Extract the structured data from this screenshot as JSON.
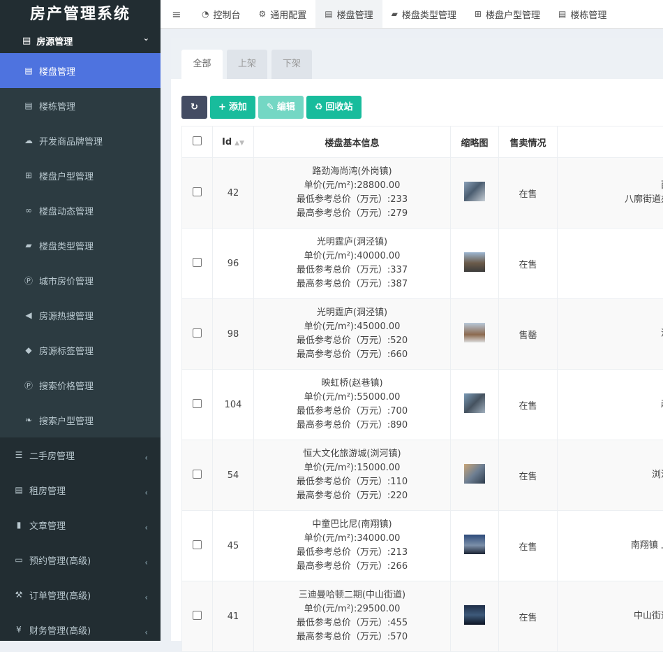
{
  "app_title": "房产管理系统",
  "sidebar": {
    "group": {
      "label": "房源管理"
    },
    "items": [
      {
        "label": "楼盘管理",
        "icon": "building-icon"
      },
      {
        "label": "楼栋管理",
        "icon": "building-icon"
      },
      {
        "label": "开发商品牌管理",
        "icon": "cloud-icon"
      },
      {
        "label": "楼盘户型管理",
        "icon": "sitemap-icon"
      },
      {
        "label": "楼盘动态管理",
        "icon": "tripadvisor-icon"
      },
      {
        "label": "楼盘类型管理",
        "icon": "book-icon"
      },
      {
        "label": "城市房价管理",
        "icon": "parking-icon"
      },
      {
        "label": "房源热搜管理",
        "icon": "bullhorn-icon"
      },
      {
        "label": "房源标签管理",
        "icon": "tags-icon"
      },
      {
        "label": "搜索价格管理",
        "icon": "parking-icon"
      },
      {
        "label": "搜索户型管理",
        "icon": "leaf-icon"
      }
    ],
    "top_items": [
      {
        "label": "二手房管理",
        "icon": "list-icon"
      },
      {
        "label": "租房管理",
        "icon": "building-icon"
      },
      {
        "label": "文章管理",
        "icon": "file-icon"
      },
      {
        "label": "预约管理(高级)",
        "icon": "laptop-icon"
      },
      {
        "label": "订单管理(高级)",
        "icon": "gavel-icon"
      },
      {
        "label": "财务管理(高级)",
        "icon": "yen-icon"
      }
    ]
  },
  "topbar": {
    "tabs": [
      {
        "label": "控制台",
        "icon": "dashboard-icon"
      },
      {
        "label": "通用配置",
        "icon": "cog-icon"
      },
      {
        "label": "楼盘管理",
        "icon": "building-icon"
      },
      {
        "label": "楼盘类型管理",
        "icon": "book-icon"
      },
      {
        "label": "楼盘户型管理",
        "icon": "sitemap-icon"
      },
      {
        "label": "楼栋管理",
        "icon": "building-icon"
      }
    ]
  },
  "status_tabs": [
    "全部",
    "上架",
    "下架"
  ],
  "toolbar": {
    "add_label": "添加",
    "edit_label": "编辑",
    "recycle_label": "回收站"
  },
  "table": {
    "headers": {
      "id": "Id",
      "info": "楼盘基本信息",
      "thumb": "缩略图",
      "sale": "售卖情况"
    },
    "rows": [
      {
        "id": "42",
        "name": "路劲海尚湾(外岗镇)",
        "price": "单价(元/m²):28800.00",
        "min": "最低参考总价（万元）:233",
        "max": "最高参考总价（万元）:279",
        "sale": "在售",
        "addr1": "西",
        "addr2": "八廓街道办"
      },
      {
        "id": "96",
        "name": "光明霆庐(洞泾镇)",
        "price": "单价(元/m²):40000.00",
        "min": "最低参考总价（万元）:337",
        "max": "最高参考总价（万元）:387",
        "sale": "在售",
        "addr1": "",
        "addr2": ""
      },
      {
        "id": "98",
        "name": "光明霆庐(洞泾镇)",
        "price": "单价(元/m²):45000.00",
        "min": "最低参考总价（万元）:520",
        "max": "最高参考总价（万元）:660",
        "sale": "售罄",
        "addr1": "",
        "addr2": "洞"
      },
      {
        "id": "104",
        "name": "映虹桥(赵巷镇)",
        "price": "单价(元/m²):55000.00",
        "min": "最低参考总价（万元）:700",
        "max": "最高参考总价（万元）:890",
        "sale": "在售",
        "addr1": "",
        "addr2": "赵"
      },
      {
        "id": "54",
        "name": "恒大文化旅游城(浏河镇)",
        "price": "单价(元/m²):15000.00",
        "min": "最低参考总价（万元）:110",
        "max": "最高参考总价（万元）:220",
        "sale": "在售",
        "addr1": "",
        "addr2": "浏河"
      },
      {
        "id": "45",
        "name": "中童巴比尼(南翔镇)",
        "price": "单价(元/m²):34000.00",
        "min": "最低参考总价（万元）:213",
        "max": "最高参考总价（万元）:266",
        "sale": "在售",
        "addr1": "",
        "addr2": "南翔镇 上"
      },
      {
        "id": "41",
        "name": "三迪曼哈顿二期(中山街道)",
        "price": "单价(元/m²):29500.00",
        "min": "最低参考总价（万元）:455",
        "max": "最高参考总价（万元）:570",
        "sale": "在售",
        "addr1": "",
        "addr2": "中山街道"
      }
    ]
  }
}
